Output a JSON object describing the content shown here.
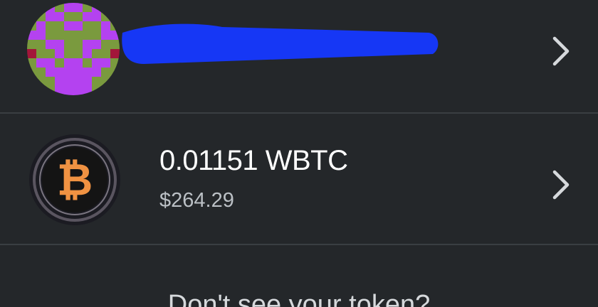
{
  "tokens": [
    {
      "icon": "identicon-avatar",
      "name_redacted": true,
      "chevron": "chevron-right-icon"
    },
    {
      "icon": "wbtc-logo-icon",
      "amount": "0.01151 WBTC",
      "fiat": "$264.29",
      "chevron": "chevron-right-icon"
    }
  ],
  "footer": {
    "prompt": "Don't see your token?"
  },
  "colors": {
    "background": "#24272a",
    "divider": "#3a3e42",
    "primary_text": "#ffffff",
    "secondary_text": "#bbc0c5",
    "chevron": "#d6d9dc",
    "btc_orange": "#f09242",
    "redaction_blue": "#1637f5",
    "identicon_purple": "#b442f0",
    "identicon_green": "#7a9a3e",
    "identicon_crimson": "#a3163a"
  }
}
